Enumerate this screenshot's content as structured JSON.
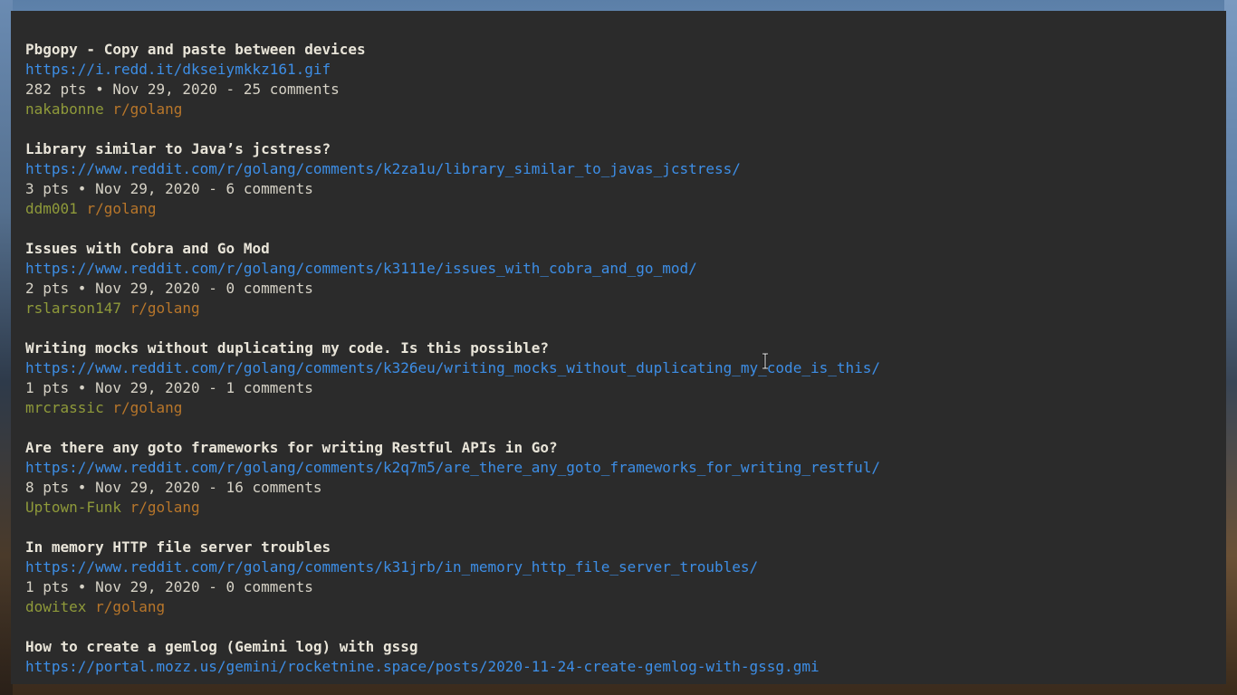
{
  "posts": [
    {
      "title": "Pbgopy - Copy and paste between devices",
      "url": "https://i.redd.it/dkseiymkkz161.gif",
      "meta": "282 pts • Nov 29, 2020 - 25 comments",
      "author": "nakabonne",
      "subreddit": "r/golang"
    },
    {
      "title": "Library similar to Java’s jcstress?",
      "url": "https://www.reddit.com/r/golang/comments/k2za1u/library_similar_to_javas_jcstress/",
      "meta": "3 pts • Nov 29, 2020 - 6 comments",
      "author": "ddm001",
      "subreddit": "r/golang"
    },
    {
      "title": "Issues with Cobra and Go Mod",
      "url": "https://www.reddit.com/r/golang/comments/k3111e/issues_with_cobra_and_go_mod/",
      "meta": "2 pts • Nov 29, 2020 - 0 comments",
      "author": "rslarson147",
      "subreddit": "r/golang"
    },
    {
      "title": "Writing mocks without duplicating my code. Is this possible?",
      "url": "https://www.reddit.com/r/golang/comments/k326eu/writing_mocks_without_duplicating_my_code_is_this/",
      "meta": "1 pts • Nov 29, 2020 - 1 comments",
      "author": "mrcrassic",
      "subreddit": "r/golang"
    },
    {
      "title": "Are there any goto frameworks for writing Restful APIs in Go?",
      "url": "https://www.reddit.com/r/golang/comments/k2q7m5/are_there_any_goto_frameworks_for_writing_restful/",
      "meta": "8 pts • Nov 29, 2020 - 16 comments",
      "author": "Uptown-Funk",
      "subreddit": "r/golang"
    },
    {
      "title": "In memory HTTP file server troubles",
      "url": "https://www.reddit.com/r/golang/comments/k31jrb/in_memory_http_file_server_troubles/",
      "meta": "1 pts • Nov 29, 2020 - 0 comments",
      "author": "dowitex",
      "subreddit": "r/golang"
    },
    {
      "title": "How to create a gemlog (Gemini log) with gssg",
      "url": "https://portal.mozz.us/gemini/rocketnine.space/posts/2020-11-24-create-gemlog-with-gssg.gmi",
      "meta": "",
      "author": "",
      "subreddit": ""
    }
  ],
  "colors": {
    "background": "#2b2b2b",
    "title": "#e8e4d8",
    "link": "#3d8ee6",
    "meta": "#d6d2c6",
    "author": "#8f9a3a",
    "subreddit": "#b8762a"
  },
  "icons": {
    "mouse_cursor": "text-cursor-icon"
  }
}
